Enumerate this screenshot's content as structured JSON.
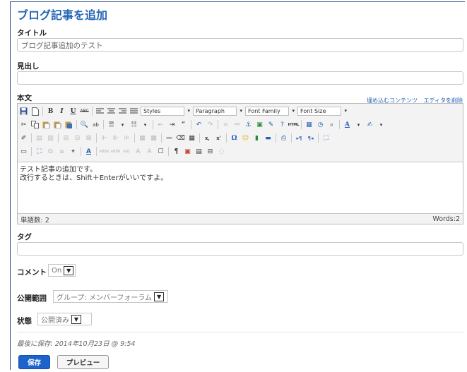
{
  "page": {
    "heading": "ブログ記事を追加"
  },
  "fields": {
    "title_label": "タイトル",
    "title_value": "ブログ記事追加のテスト",
    "subtitle_label": "見出し",
    "subtitle_value": "",
    "body_label": "本文",
    "tags_label": "タグ",
    "tags_value": ""
  },
  "editor": {
    "link_embed": "埋め込むコンテンツ",
    "link_remove": "エディタを削除",
    "dropdowns": {
      "styles": "Styles",
      "format": "Paragraph",
      "font_family": "Font Family",
      "font_size": "Font Size"
    },
    "buttons": {
      "bold": "B",
      "italic": "I",
      "underline": "U",
      "strike": "ABC",
      "quote": "“",
      "omega": "Ω",
      "hr": "—",
      "sub": "x,",
      "sup": "x'",
      "pilcrow": "¶",
      "font_color": "A",
      "abbr": "ABBR"
    },
    "content_line1": "テスト記事の追加です。",
    "content_line2": "改行するときは、Shift＋Enterがいいですよ。",
    "footer_left": "単語数: 2",
    "footer_right": "Words:2"
  },
  "options": {
    "comment_label": "コメント",
    "comment_value": "On",
    "visibility_label": "公開範囲",
    "visibility_value": "グループ: メンバーフォーラム",
    "status_label": "状態",
    "status_value": "公開済み"
  },
  "footer": {
    "last_saved": "最後に保存: 2014年10月23日 @ 9:54",
    "save_button": "保存",
    "preview_button": "プレビュー"
  },
  "colors": {
    "heading": "#2466b5",
    "save_bg": "#1c63cc",
    "frame": "#2a4f86"
  }
}
